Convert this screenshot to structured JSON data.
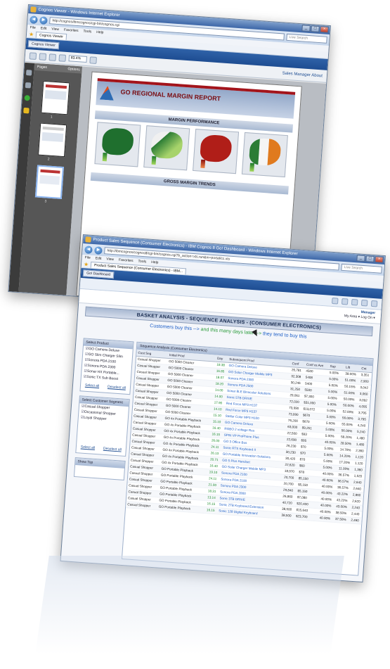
{
  "back_window": {
    "title": "Cognos Viewer - Windows Internet Explorer",
    "address": "http://cognos/ibmcognos/cgi-bin/cognos.cgi",
    "search_placeholder": "Live Search",
    "menu": [
      "File",
      "Edit",
      "View",
      "Favorites",
      "Tools",
      "Help"
    ],
    "tab": "Cognos Viewer",
    "ribbon_label": "Cognos Viewer",
    "zoom": "83.4%",
    "toolbar_right": "Sales Manager   About",
    "pages_label": "Pages",
    "options_label": "Options",
    "page_numbers": [
      "1",
      "2",
      "3"
    ],
    "report_title": "GO REGIONAL MARGIN REPORT",
    "section_margin": "MARGIN PERFORMANCE",
    "section_growth": "GROSS MARGIN TRENDS"
  },
  "front_window": {
    "title": "Product Sales Sequence (Consumer Electronics) - IBM Cognos 8 Go! Dashboard - Windows Internet Explorer",
    "address": "http://ibmcognos/cognos8/cgi-bin/cognos.cgi?b_action=xts.run&m=portal/cc.xts",
    "search_placeholder": "Live Search",
    "menu": [
      "File",
      "Edit",
      "View",
      "Favorites",
      "Tools",
      "Help"
    ],
    "tab": "Product Sales Sequence (Consumer Electronics) - IBM...",
    "dashboard_label": "Go! Dashboard",
    "user_name": "Manager",
    "user_links": "My Area ▾  Log On ▾",
    "report_title": "BASKET ANALYSIS - SEQUENCE ANALYSIS - (CONSUMER ELECTRONICS)",
    "subline_a": "Customers buy this --> ",
    "subline_b": "and this many days later --> ",
    "subline_c": "they tend to buy this",
    "filter1_title": "Select Product",
    "filter1_items": [
      "GO Camera Deluxe",
      "GO Slim Charger Slim",
      "Sonora PDA 2100",
      "Sonora PDA 2300",
      "Sonar HX Portable...",
      "Sonic TX Sub Boost"
    ],
    "filter2_title": "Select Customer Segment",
    "filter2_items": [
      "Casual Shopper",
      "Occasional Shopper",
      "Loyal Shopper"
    ],
    "select_all": "Select all",
    "deselect_all": "Deselect all",
    "filter3_title": "Show Top",
    "grid_title": "Sequence Analysis (Consumer Electronics)",
    "columns": [
      "Cust Seg",
      "Initial Prod",
      "Day",
      "Subsequent Prod",
      "Conf",
      "Conf vs Ave",
      "Sup",
      "Lift",
      "Cnt"
    ],
    "rows": [
      [
        "Casual Shopper",
        "GO 5000 Cleaner",
        "18.38",
        "GO Camera Deluxe",
        "26,781",
        "4500",
        "5.00%",
        "38.00%",
        "3,351"
      ],
      [
        "Casual Shopper",
        "GO 5000 Cleaner",
        "16.85",
        "GO Solar Charger Mobile MP3",
        "32,308",
        "5408",
        "5.00%",
        "51.00%",
        "2,900"
      ],
      [
        "Casual Shopper",
        "GO 5000 Cleaner",
        "18.07",
        "Sonora PDA 2300",
        "30,246",
        "5400",
        "5.00%",
        "50.15%",
        "3,042"
      ],
      [
        "Casual Shopper",
        "GO 5000 Cleaner",
        "18.20",
        "Sonora PDA 2500",
        "31,250",
        "5500",
        "5.00%",
        "51.00%",
        "3,060"
      ],
      [
        "Casual Shopper",
        "GO 5000 Cleaner",
        "14.00",
        "Sonar 8LE Binocular Solutions",
        "29,061",
        "$7,300",
        "5.00%",
        "50.00%",
        "3,092"
      ],
      [
        "Casual Shopper",
        "GO 5000 Cleaner",
        "14.00",
        "Sonic 5TB DRIVE",
        "72,020",
        "$31,000",
        "5.00%",
        "50.00%",
        "4,095"
      ],
      [
        "Casual Shopper",
        "GO 5000 Cleaner",
        "17.90",
        "Red Force MP3 H137",
        "73,990",
        "$13,072",
        "5.00%",
        "52.00%",
        "3,795"
      ],
      [
        "Casual Shopper",
        "GO 5000 Cleaner",
        "14.10",
        "Red Force MP3 H137",
        "73,990",
        "$670",
        "5.00%",
        "56.00%",
        "3,795"
      ],
      [
        "Casual Shopper",
        "GO 5000 Cleaner",
        "15.10",
        "Stellar Color MP3 H100",
        "76,200",
        "$670",
        "5.00%",
        "55.00%",
        "4,240"
      ],
      [
        "Casual Shopper",
        "GO 4x Portable Playback",
        "15.10",
        "GO Camera Deluxe",
        "63,000",
        "$9,251",
        "5.00%",
        "56.00%",
        "5,240"
      ],
      [
        "Casual Shopper",
        "GO 4x Portable Playback",
        "16.40",
        "RGBO 2 voltage Res",
        "22,500",
        "$93",
        "5.00%",
        "58.20%",
        "1,480"
      ],
      [
        "Casual Shopper",
        "GO 4x Portable Playback",
        "16.15",
        "SPIN VP ProPhone Plus",
        "22,690",
        "$95",
        "40.00%",
        "28.50%",
        "1,480"
      ],
      [
        "Casual Shopper",
        "GO 4x Portable Playback",
        "26.00",
        "GO 3 Office Bus",
        "26,230",
        "$70",
        "5.00%",
        "14.70%",
        "2,360"
      ],
      [
        "Casual Shopper",
        "GO 4x Portable Playback",
        "24.11",
        "Sonic RTS Keyboard II",
        "30,230",
        "$70",
        "5.00%",
        "14.20%",
        "1,120"
      ],
      [
        "Casual Shopper",
        "GO 4x Portable Playback",
        "26.13",
        "GO Portable Innovation Solutions",
        "30,420",
        "$70",
        "5.00%",
        "17.20%",
        "1,120"
      ],
      [
        "Casual Shopper",
        "GO 4x Portable Playback",
        "20.71",
        "GO 5 Plus Handset",
        "22,620",
        "$60",
        "5.00%",
        "11.00%",
        "1,360"
      ],
      [
        "Casual Shopper",
        "GO 4x Portable Playback",
        "16.40",
        "GO Solar Charger Mobile MP3",
        "18,970",
        "$78",
        "40.00%",
        "36.57%",
        "1,520"
      ],
      [
        "Casual Shopper",
        "GO Portable Playback",
        "19.10",
        "Sonora PDA 2100",
        "20,700",
        "$5,150",
        "40.00%",
        "36.57%",
        "2,640"
      ],
      [
        "Casual Shopper",
        "GO Portable Playback",
        "24.11",
        "Sonora PDA 2100",
        "20,700",
        "$5,150",
        "40.00%",
        "36.57%",
        "2,640"
      ],
      [
        "Casual Shopper",
        "GO Portable Playback",
        "21.00",
        "Sonora PDA 2300",
        "29,840",
        "$5,150",
        "40.00%",
        "43.22%",
        "2,860"
      ],
      [
        "Casual Shopper",
        "GO Portable Playback",
        "18.31",
        "Sonora PDA 2800",
        "26,860",
        "$7,080",
        "40.00%",
        "43.22%",
        "2,620"
      ],
      [
        "Casual Shopper",
        "GO Portable Playback",
        "13.14",
        "Sonic 3TB DRIVE",
        "40,720",
        "$20,400",
        "40.00%",
        "43.00%",
        "2,240"
      ],
      [
        "Casual Shopper",
        "GO Portable Playback",
        "16.15",
        "Sonic 2TB Keyboard Extension",
        "38,500",
        "$15,640",
        "40.00%",
        "38.50%",
        "2,440"
      ],
      [
        "Casual Shopper",
        "GO Portable Playback",
        "16.15",
        "Sonic 128 Digital Keyboard",
        "38,500",
        "$23,700",
        "40.00%",
        "37.50%",
        "2,460"
      ]
    ]
  }
}
